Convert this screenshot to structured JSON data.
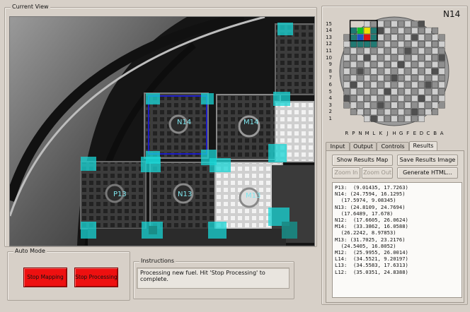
{
  "current_view": {
    "title": "Current View",
    "image_labels": [
      "N14",
      "M14",
      "P13",
      "N13",
      "M13"
    ]
  },
  "auto_mode": {
    "title": "Auto Mode",
    "stop_mapping_label": "Stop Mapping",
    "stop_processing_label": "Stop Processing"
  },
  "instructions": {
    "title": "Instructions",
    "text": "Processing new fuel.  Hit 'Stop Processing' to complete."
  },
  "core_map": {
    "selected_label": "N14",
    "row_labels": [
      "15",
      "14",
      "13",
      "12",
      "11",
      "10",
      "9",
      "8",
      "7",
      "6",
      "5",
      "4",
      "3",
      "2",
      "1"
    ],
    "col_labels": [
      "R",
      "P",
      "N",
      "M",
      "L",
      "K",
      "J",
      "H",
      "G",
      "F",
      "E",
      "D",
      "C",
      "B",
      "A"
    ],
    "colors": {
      "full": "#8f8f8f",
      "light": "#cfcfcf",
      "dark": "#505050",
      "highlight_green": "#13c02a",
      "highlight_yellow": "#f0e000",
      "highlight_red": "#e01616",
      "highlight_blue": "#1b54c8",
      "teal": "#207a73"
    }
  },
  "tabs": [
    {
      "label": "Input",
      "active": false
    },
    {
      "label": "Output",
      "active": false
    },
    {
      "label": "Controls",
      "active": false
    },
    {
      "label": "Results",
      "active": true
    }
  ],
  "results_panel": {
    "show_map_label": "Show Results Map",
    "save_image_label": "Save Results Image",
    "zoom_in_label": "Zoom In",
    "zoom_out_label": "Zoom Out",
    "generate_html_label": "Generate HTML...",
    "lines": [
      "P13:  (9.01435, 17.7263)",
      "N14: (24.7594, 16.1295)",
      "  (17.5974, 9.08345)",
      "N13: (24.8109, 24.7694)",
      "  (17.6489, 17.678)",
      "N12:  (17.6605, 26.0624)",
      "M14:  (33.3862, 16.0588)",
      "  (26.2242, 8.97853)",
      "M13: (31.7025, 23.2176)",
      "  (24.5405, 16.8052)",
      "M12:  (25.9955, 26.0014)",
      "L14:  (34.5521, 9.20197)",
      "L13:  (34.5583, 17.6313)",
      "L12:  (35.0351, 24.8388)"
    ]
  }
}
